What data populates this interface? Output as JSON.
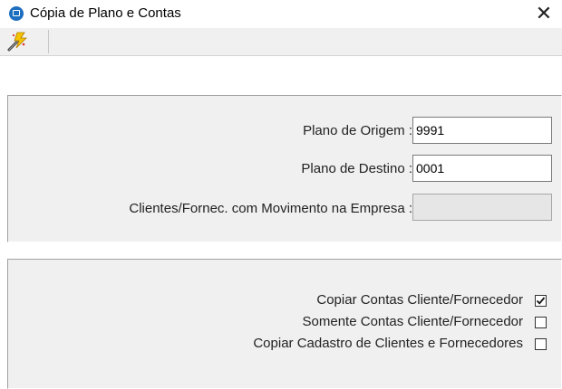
{
  "window": {
    "title": "Cópia de Plano e Contas",
    "icon": "app-window-icon",
    "close_glyph": "✕"
  },
  "toolbar": {
    "items": [
      {
        "icon": "lightning-wand-icon"
      }
    ]
  },
  "form": {
    "plano_origem": {
      "label": "Plano de Origem :",
      "value": "9991"
    },
    "plano_destino": {
      "label": "Plano de Destino :",
      "value": "0001"
    },
    "clientes_fornec": {
      "label": "Clientes/Fornec. com Movimento na Empresa :",
      "value": ""
    }
  },
  "options": [
    {
      "label": "Copiar Contas Cliente/Fornecedor",
      "checked": true
    },
    {
      "label": "Somente Contas Cliente/Fornecedor",
      "checked": false
    },
    {
      "label": "Copiar Cadastro de Clientes e Fornecedores",
      "checked": false
    }
  ],
  "colors": {
    "panel_bg": "#f0f0f0",
    "app_icon": "#1e6fbf",
    "input_disabled": "#e6e6e6"
  }
}
